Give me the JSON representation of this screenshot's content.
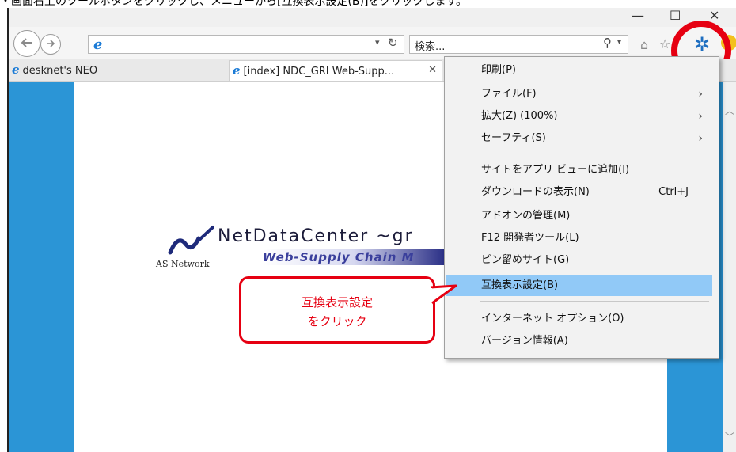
{
  "instruction": {
    "text": "・画面右上のツールボタンをクリックし、メニューから[互換表示設定(B)]をクリックします。"
  },
  "window": {
    "controls": {
      "minimize": "—",
      "maximize": "☐",
      "close": "✕"
    }
  },
  "toolbar": {
    "search_placeholder": "検索...",
    "url_dropdown": "▾",
    "refresh": "↻",
    "search_glyph": "⚲",
    "search_dropdown": "▾",
    "icons": [
      "back-icon",
      "forward-icon",
      "ie-icon",
      "home-icon",
      "star-icon",
      "gear-icon",
      "smiley-icon"
    ]
  },
  "tabs": [
    {
      "label": "desknet's NEO",
      "active": false
    },
    {
      "label": "[index] NDC_GRI Web-Supp...",
      "active": true,
      "close": "✕"
    }
  ],
  "page": {
    "logo_main": "NetDataCenter ~gr",
    "logo_sub": "Web-Supply Chain M",
    "logo_as": "AS Network"
  },
  "menu": {
    "items": [
      {
        "label": "印刷(P)",
        "arrow": "",
        "shortcut": ""
      },
      {
        "label": "ファイル(F)",
        "arrow": "›",
        "shortcut": ""
      },
      {
        "label": "拡大(Z) (100%)",
        "arrow": "›",
        "shortcut": ""
      },
      {
        "label": "セーフティ(S)",
        "arrow": "›",
        "shortcut": ""
      },
      {
        "label": "サイトをアプリ ビューに追加(I)",
        "arrow": "",
        "shortcut": ""
      },
      {
        "label": "ダウンロードの表示(N)",
        "arrow": "",
        "shortcut": "Ctrl+J"
      },
      {
        "label": "アドオンの管理(M)",
        "arrow": "",
        "shortcut": ""
      },
      {
        "label": "F12 開発者ツール(L)",
        "arrow": "",
        "shortcut": ""
      },
      {
        "label": "ピン留めサイト(G)",
        "arrow": "",
        "shortcut": ""
      },
      {
        "label": "互換表示設定(B)",
        "arrow": "",
        "shortcut": "",
        "active": true
      },
      {
        "label": "インターネット オプション(O)",
        "arrow": "",
        "shortcut": ""
      },
      {
        "label": "バージョン情報(A)",
        "arrow": "",
        "shortcut": ""
      }
    ]
  },
  "callout": {
    "line1": "互換表示設定",
    "line2": "をクリック"
  },
  "colors": {
    "accent_red": "#e60012",
    "menu_highlight": "#91c9f7",
    "page_blue": "#2b95d6",
    "gear_blue": "#1e6ec0"
  }
}
